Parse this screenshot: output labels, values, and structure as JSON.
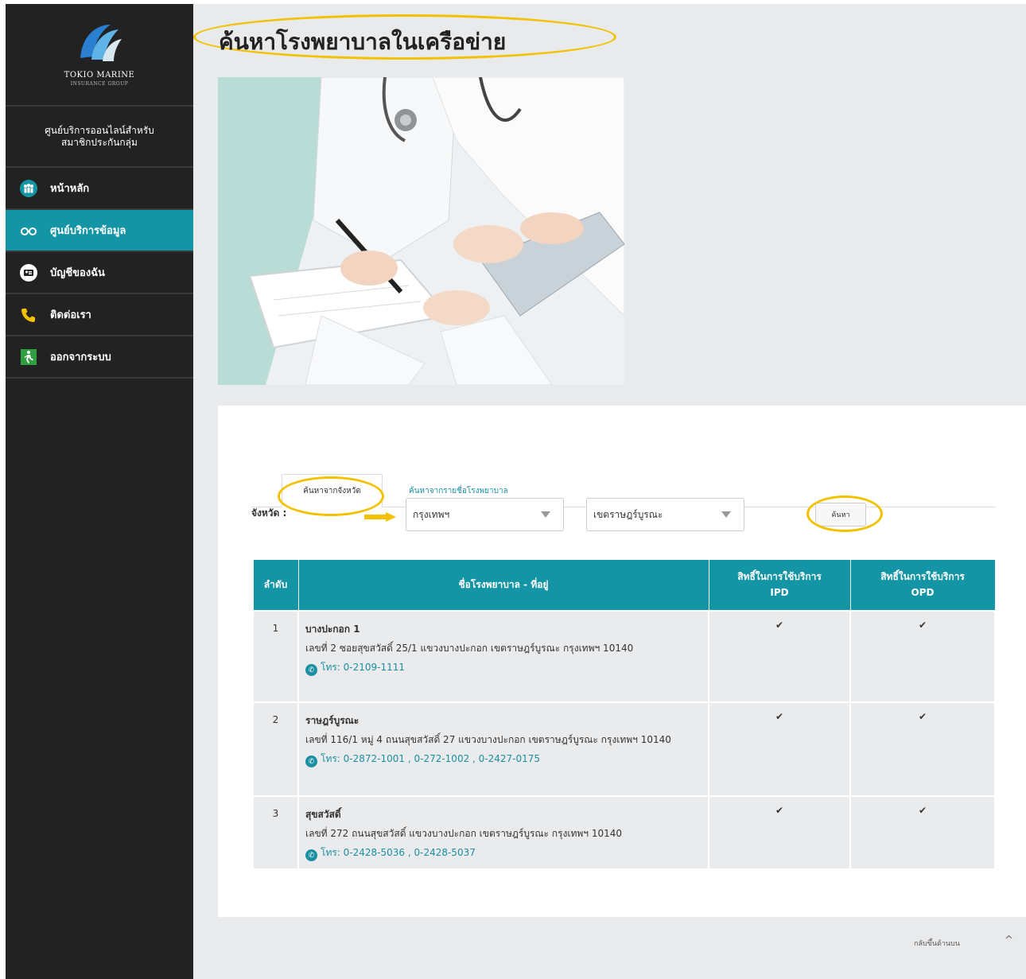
{
  "sidebar": {
    "logo_line1": "TOKIO MARINE",
    "logo_line2": "INSURANCE GROUP",
    "center_title_line1": "ศูนย์บริการออนไลน์สำหรับ",
    "center_title_line2": "สมาชิกประกันกลุ่ม",
    "items": [
      {
        "label": "หน้าหลัก",
        "icon": "family-icon"
      },
      {
        "label": "ศูนย์บริการข้อมูล",
        "icon": "glasses-icon",
        "active": true
      },
      {
        "label": "บัญชีของฉัน",
        "icon": "id-card-icon"
      },
      {
        "label": "ติดต่อเรา",
        "icon": "phone-icon"
      },
      {
        "label": "ออกจากระบบ",
        "icon": "exit-icon"
      }
    ]
  },
  "page": {
    "title": "ค้นหาโรงพยาบาลในเครือข่าย"
  },
  "search": {
    "tabs": [
      "ค้นหาจากจังหวัด",
      "ค้นหาจากรายชื่อโรงพยาบาล"
    ],
    "province_label": "จังหวัด :",
    "province_value": "กรุงเทพฯ",
    "district_value": "เขตราษฎร์บูรณะ",
    "button_label": "ค้นหา"
  },
  "table": {
    "headers": {
      "no": "ลำดับ",
      "name": "ชื่อโรงพยาบาล - ที่อยู่",
      "ipd_line1": "สิทธิ์ในการใช้บริการ",
      "ipd_line2": "IPD",
      "opd_line1": "สิทธิ์ในการใช้บริการ",
      "opd_line2": "OPD"
    },
    "rows": [
      {
        "no": "1",
        "name": "บางปะกอก 1",
        "address": "เลขที่ 2 ซอยสุขสวัสดิ์ 25/1 แขวงบางปะกอก เขตราษฎร์บูรณะ กรุงเทพฯ 10140",
        "phone": "โทร: 0-2109-1111",
        "ipd": "✔",
        "opd": "✔"
      },
      {
        "no": "2",
        "name": "ราษฎร์บูรณะ",
        "address": "เลขที่ 116/1 หมู่ 4 ถนนสุขสวัสดิ์ 27 แขวงบางปะกอก เขตราษฎร์บูรณะ กรุงเทพฯ 10140",
        "phone": "โทร: 0-2872-1001 , 0-272-1002 , 0-2427-0175",
        "ipd": "✔",
        "opd": "✔"
      },
      {
        "no": "3",
        "name": "สุขสวัสดิ์",
        "address": "เลขที่ 272 ถนนสุขสวัสดิ์ แขวงบางปะกอก เขตราษฎร์บูรณะ กรุงเทพฯ 10140",
        "phone": "โทร: 0-2428-5036 , 0-2428-5037",
        "ipd": "✔",
        "opd": "✔"
      }
    ]
  },
  "footer": {
    "back_to_top": "กลับขึ้นด้านบน",
    "back_to_top_icon": "^"
  },
  "colors": {
    "sidebar_bg": "#222222",
    "accent": "#1495a6",
    "highlight": "#f2c200",
    "main_bg": "#e8eaeb"
  }
}
